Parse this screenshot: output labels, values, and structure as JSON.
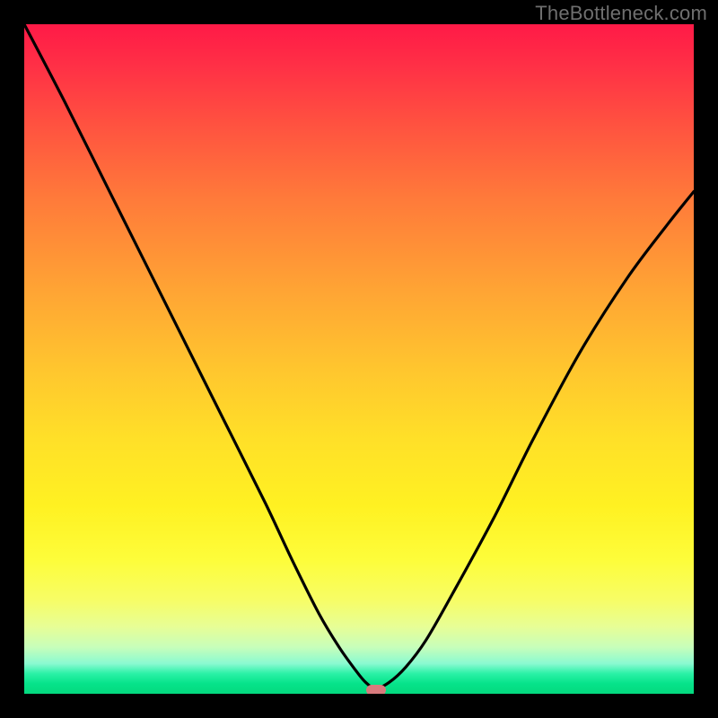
{
  "watermark": "TheBottleneck.com",
  "marker": {
    "x_fraction": 0.525,
    "y_fraction": 0.995
  },
  "colors": {
    "frame": "#000000",
    "curve": "#000000",
    "marker": "#d87a7d",
    "watermark": "#6f6f6f",
    "gradient_stops": [
      "#ff1a47",
      "#ff2f46",
      "#ff5240",
      "#ff7a3a",
      "#ffa534",
      "#ffc72e",
      "#ffe028",
      "#fff122",
      "#fdfd3a",
      "#f7fd66",
      "#e7fe96",
      "#c8feba",
      "#8afad1",
      "#2af1a6",
      "#06e38a",
      "#04d97f"
    ]
  },
  "chart_data": {
    "type": "line",
    "title": "",
    "xlabel": "",
    "ylabel": "",
    "xlim": [
      0,
      1
    ],
    "ylim": [
      0,
      1
    ],
    "note": "x and y are normalized fractions of the plot area (0 = left/top edge, 1 = right/bottom edge). The curve is a V-shaped bottleneck profile with its minimum near x≈0.525.",
    "series": [
      {
        "name": "bottleneck-curve",
        "x": [
          0.0,
          0.06,
          0.12,
          0.18,
          0.24,
          0.3,
          0.36,
          0.4,
          0.44,
          0.47,
          0.495,
          0.51,
          0.525,
          0.545,
          0.57,
          0.6,
          0.64,
          0.7,
          0.76,
          0.83,
          0.9,
          0.96,
          1.0
        ],
        "y": [
          0.0,
          0.115,
          0.235,
          0.355,
          0.475,
          0.595,
          0.715,
          0.8,
          0.88,
          0.93,
          0.965,
          0.983,
          0.992,
          0.983,
          0.96,
          0.92,
          0.85,
          0.74,
          0.62,
          0.49,
          0.38,
          0.3,
          0.25
        ]
      }
    ]
  }
}
